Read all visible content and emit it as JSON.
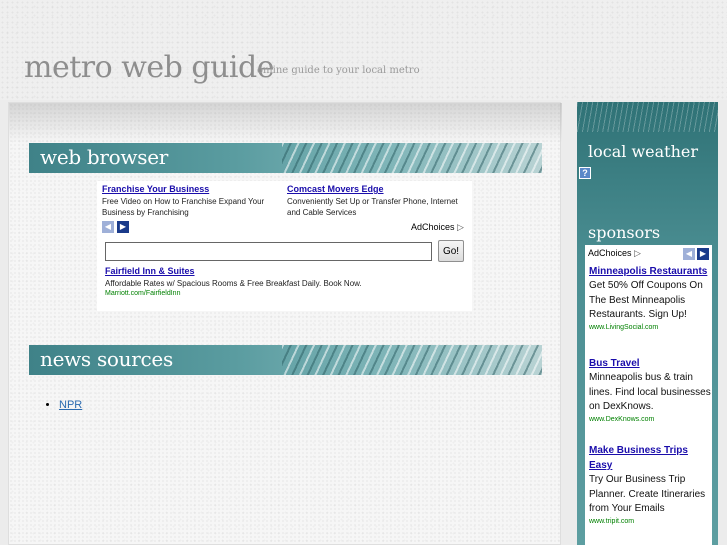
{
  "header": {
    "title": "metro web guide",
    "tagline": "online guide to your local metro"
  },
  "web_browser": {
    "title": "web browser",
    "ads": [
      {
        "link": "Franchise Your Business",
        "desc": "Free Video on How to Franchise Expand Your Business by Franchising"
      },
      {
        "link": "Comcast Movers Edge",
        "desc": "Conveniently Set Up or Transfer Phone, Internet and Cable Services"
      }
    ],
    "adchoices": "AdChoices",
    "search": {
      "value": "",
      "go_label": "Go!"
    },
    "search_ad": {
      "link": "Fairfield Inn & Suites",
      "desc": "Affordable Rates w/ Spacious Rooms & Free Breakfast Daily. Book Now.",
      "url": "Marriott.com/FairfieldInn"
    }
  },
  "news_sources": {
    "title": "news sources",
    "items": [
      "NPR"
    ]
  },
  "sidebar": {
    "weather_title": "local weather",
    "weather_help": "?",
    "sponsors_title": "sponsors",
    "adchoices": "AdChoices",
    "ads": [
      {
        "link": "Minneapolis Restaurants",
        "desc": "Get 50% Off Coupons On The Best Minneapolis Restaurants. Sign Up!",
        "url": "www.LivingSocial.com"
      },
      {
        "link": "Bus Travel",
        "desc": "Minneapolis bus & train lines. Find local businesses on DexKnows.",
        "url": "www.DexKnows.com"
      },
      {
        "link": "Make Business Trips Easy",
        "desc": "Try Our Business Trip Planner. Create Itineraries from Your Emails",
        "url": "www.tripit.com"
      }
    ]
  },
  "icons": {
    "prev": "chevron-left-icon",
    "next": "chevron-right-icon",
    "adchoices": "adchoices-triangle-icon"
  },
  "colors": {
    "teal_band": "#3f8288",
    "ad_link": "#1a0dab",
    "ad_url": "#008000",
    "news_link": "#2b6bb0",
    "nav_prev": "#9fb0d8",
    "nav_next": "#1a3a8a"
  }
}
